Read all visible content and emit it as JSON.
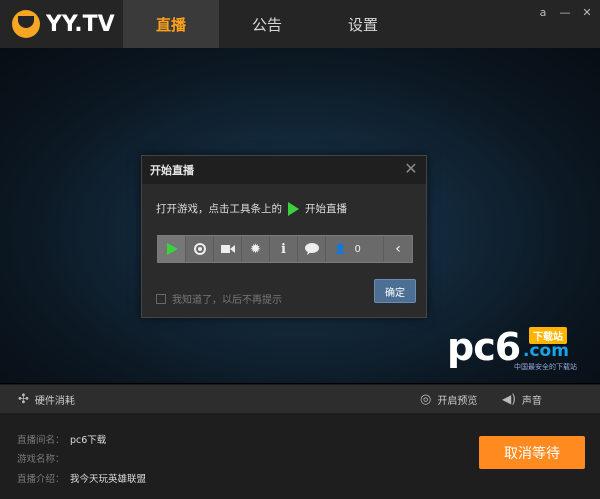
{
  "app": {
    "logo_text": "YY.TV"
  },
  "tabs": [
    {
      "label": "直播",
      "active": true
    },
    {
      "label": "公告",
      "active": false
    },
    {
      "label": "设置",
      "active": false
    }
  ],
  "window_controls": {
    "skin": "a",
    "minimize": "—",
    "close": "✕"
  },
  "dialog": {
    "title": "开始直播",
    "message_prefix": "打开游戏，点击工具条上的",
    "message_action": "开始直播",
    "toolbar": {
      "viewer_count": "0",
      "buttons": [
        "play-icon",
        "record-icon",
        "camera-icon",
        "gear-icon",
        "info-icon",
        "chat-icon",
        "person-icon",
        "chevron-left-icon"
      ]
    },
    "checkbox_label": "我知道了，以后不再提示",
    "ok_label": "确定"
  },
  "watermark": {
    "text": "pc6",
    "badge": "下载站",
    "com": ".com",
    "sub": "中国最安全的下载站"
  },
  "status": {
    "hardware_label": "硬件消耗",
    "preview_label": "开启预览",
    "sound_label": "声音"
  },
  "info": {
    "room_key": "直播间名：",
    "room_value": "pc6下载",
    "game_key": "游戏名称：",
    "game_value": "",
    "intro_key": "直播介绍：",
    "intro_value": "我今天玩英雄联盟"
  },
  "cancel_label": "取消等待",
  "colors": {
    "accent": "#ffa21a",
    "button": "#ff8a1f",
    "play": "#3cd23c"
  }
}
